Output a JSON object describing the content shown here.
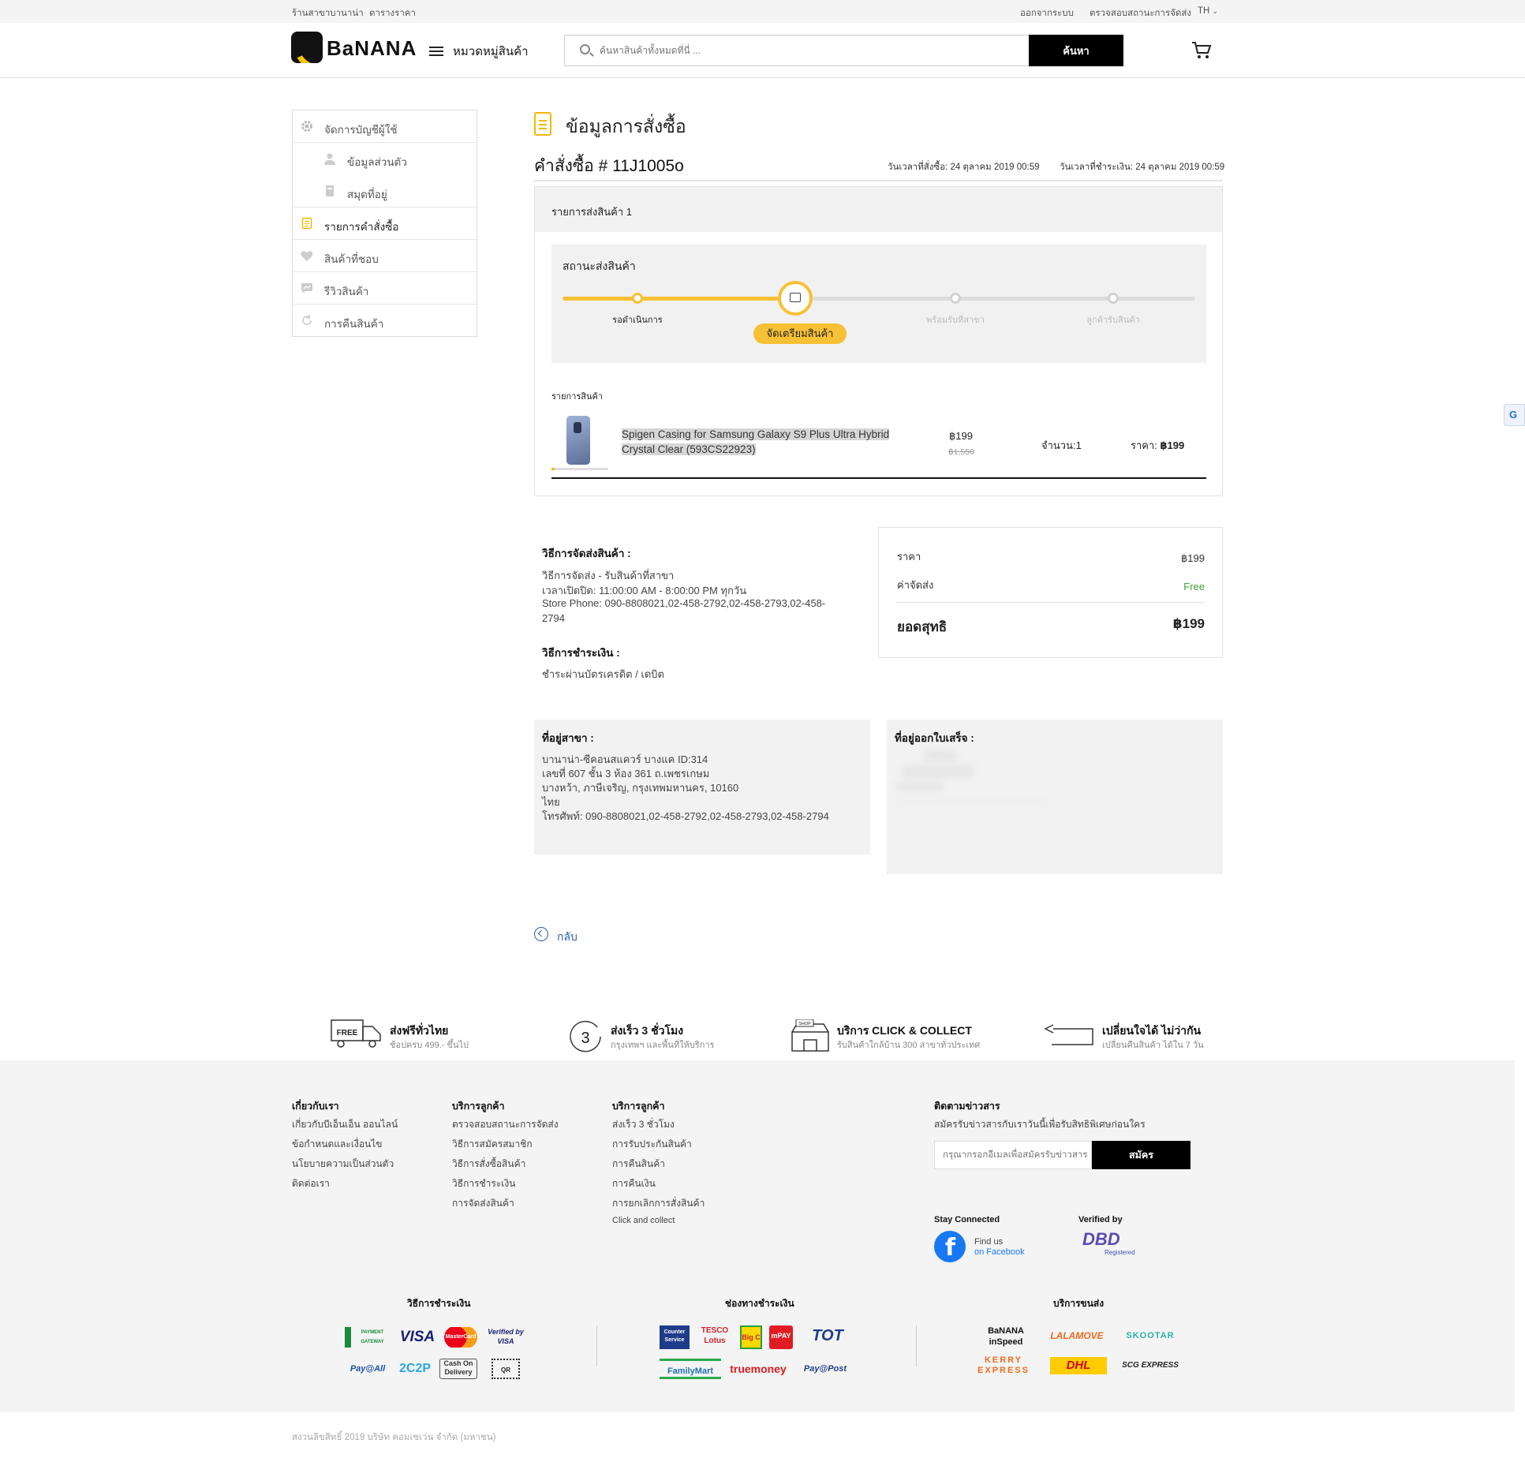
{
  "topbar": {
    "store_link": "ร้านสาขาบานาน่า",
    "price_link": "ตารางราคา",
    "logout": "ออกจากระบบ",
    "track": "ตรวจสอบสถานะการจัดส่ง",
    "lang": "TH"
  },
  "header": {
    "logo": "BaNANA",
    "categories": "หมวดหมู่สินค้า",
    "search_placeholder": "ค้นหาสินค้าทั้งหมดที่นี่ ...",
    "search_button": "ค้นหา"
  },
  "sidebar": {
    "items": [
      {
        "label": "จัดการบัญชีผู้ใช้"
      },
      {
        "label": "ข้อมูลส่วนตัว"
      },
      {
        "label": "สมุดที่อยู่"
      },
      {
        "label": "รายการคำสั่งซื้อ"
      },
      {
        "label": "สินค้าที่ชอบ"
      },
      {
        "label": "รีวิวสินค้า"
      },
      {
        "label": "การคืนสินค้า"
      }
    ]
  },
  "order": {
    "page_title": "ข้อมูลการสั่งซื้อ",
    "order_number": "คำสั่งซื้อ # 11J1005o",
    "order_time": "วันเวลาที่สั่งซื้อ: 24 ตุลาคม 2019 00:59",
    "paid_time": "วันเวลาที่ชำระเงิน: 24 ตุลาคม 2019 00:59",
    "shipment_label": "รายการส่งสินค้า 1",
    "status_title": "สถานะส่งสินค้า",
    "progress_fraction": 0.375,
    "steps": [
      {
        "label": "รอดำเนินการ",
        "state": "done"
      },
      {
        "label": "จัดเตรียมสินค้า",
        "state": "current"
      },
      {
        "label": "พร้อมรับที่สาขา",
        "state": "pending"
      },
      {
        "label": "ลูกค้ารับสินค้า",
        "state": "pending"
      }
    ],
    "products_heading": "รายการสินค้า",
    "product": {
      "name": "Spigen Casing for Samsung Galaxy S9 Plus Ultra Hybrid Crystal Clear (593CS22923)",
      "price": "฿199",
      "old_price": "฿1,550",
      "qty": "จำนวน:1",
      "total_label": "ราคา:",
      "total_value": "฿199"
    }
  },
  "shipping": {
    "title": "วิธีการจัดส่งสินค้า :",
    "lines": [
      "วิธีการจัดส่ง - รับสินค้าที่สาขา",
      "เวลาเปิดปิด: 11:00:00 AM - 8:00:00 PM ทุกวัน",
      "Store Phone: 090-8808021,02-458-2792,02-458-2793,02-458-",
      "2794"
    ]
  },
  "payment": {
    "title": "วิธีการชำระเงิน :",
    "method": "ชำระผ่านบัตรเครดิต / เดบิต"
  },
  "summary": {
    "price_label": "ราคา",
    "price_value": "฿199",
    "shipping_label": "ค่าจัดส่ง",
    "shipping_value": "Free",
    "net_label": "ยอดสุทธิ",
    "net_value": "฿199"
  },
  "branch_address": {
    "title": "ที่อยู่สาขา :",
    "lines": [
      "บานาน่า-ซีคอนสแควร์ บางแค ID:314",
      "เลขที่ 607 ชั้น 3 ห้อง 361 ถ.เพชรเกษม",
      "บางหว้า, ภาษีเจริญ, กรุงเทพมหานคร, 10160",
      "ไทย",
      "โทรศัพท์: 090-8808021,02-458-2792,02-458-2793,02-458-2794"
    ]
  },
  "billing_address": {
    "title": "ที่อยู่ออกใบเสร็จ :"
  },
  "back_label": "กลับ",
  "features": [
    {
      "title": "ส่งฟรีทั่วไทย",
      "sub": "ช้อปครบ 499.- ขึ้นไป",
      "badge": "FREE"
    },
    {
      "title": "ส่งเร็ว 3 ชั่วโมง",
      "sub": "กรุงเทพฯ และพื้นที่ให้บริการ",
      "badge": "3"
    },
    {
      "title": "บริการ CLICK & COLLECT",
      "sub": "รับสินค้าใกล้บ้าน 300 สาขาทั่วประเทศ",
      "badge": "SHOP"
    },
    {
      "title": "เปลี่ยนใจได้ ไม่ว่ากัน",
      "sub": "เปลี่ยนคืนสินค้า ได้ใน 7 วัน"
    }
  ],
  "footer": {
    "col1": {
      "title": "เกี่ยวกับเรา",
      "links": [
        "เกี่ยวกับบีเอ็นเอ็น ออนไลน์",
        "ข้อกำหนดและเงื่อนไข",
        "นโยบายความเป็นส่วนตัว",
        "ติดต่อเรา"
      ]
    },
    "col2": {
      "title": "บริการลูกค้า",
      "links": [
        "ตรวจสอบสถานะการจัดส่ง",
        "วิธีการสมัครสมาชิก",
        "วิธีการสั่งซื้อสินค้า",
        "วิธีการชำระเงิน",
        "การจัดส่งสินค้า"
      ]
    },
    "col3": {
      "title": "บริการลูกค้า",
      "links": [
        "ส่งเร็ว 3 ชั่วโมง",
        "การรับประกันสินค้า",
        "การคืนสินค้า",
        "การคืนเงิน",
        "การยกเลิกการสั่งสินค้า",
        "Click and collect"
      ]
    },
    "newsletter": {
      "title": "ติดตามข่าวสาร",
      "desc": "สมัครรับข่าวสารกับเราวันนี้เพื่อรับสิทธิพิเศษก่อนใคร",
      "placeholder": "กรุณากรอกอีเมลเพื่อสมัครรับข่าวสาร",
      "button": "สมัคร"
    },
    "stay_connected": "Stay Connected",
    "find_us": "Find us",
    "on_facebook": "on Facebook",
    "verified_by": "Verified by",
    "dbd_text": "DBD",
    "dbd_registered": "Registered",
    "payment_methods_title": "วิธีการชำระเงิน",
    "payment_channels_title": "ช่องทางชำระเงิน",
    "shipping_title": "บริการขนส่ง",
    "payment_logos": [
      "PAYMENT GATEWAY",
      "VISA",
      "MasterCard",
      "Verified by VISA",
      "Pay@All",
      "2C2P",
      "Cash On Delivery",
      "QR"
    ],
    "channel_logos": [
      "Counter Service",
      "TESCO Lotus",
      "Big C",
      "mPAY",
      "TOT",
      "FamilyMart",
      "truemoney",
      "Pay@Post"
    ],
    "shipping_logos": [
      "BaNANA inSpeed",
      "LALAMOVE",
      "SKOOTAR",
      "KERRY EXPRESS",
      "DHL",
      "SCG EXPRESS"
    ],
    "copyright": "สงวนลิขสิทธิ์ 2019 บริษัท คอมเซเว่น จำกัด (มหาชน)"
  },
  "colors": {
    "accent_yellow": "#f7c035",
    "link_blue": "#2b5fa8",
    "free_green": "#3aa33a"
  }
}
